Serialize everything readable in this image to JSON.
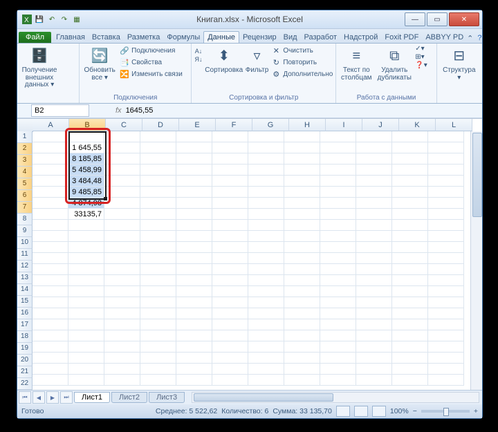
{
  "title": "Книгаn.xlsx - Microsoft Excel",
  "tabs": {
    "file": "Файл",
    "list": [
      "Главная",
      "Вставка",
      "Разметка",
      "Формулы",
      "Данные",
      "Рецензир",
      "Вид",
      "Разработ",
      "Надстрой",
      "Foxit PDF",
      "ABBYY PD"
    ],
    "active": 4
  },
  "ribbon": {
    "g1": {
      "b1": "Получение\nвнешних данных ▾",
      "label": ""
    },
    "g2": {
      "b1": "Обновить\nвсе ▾",
      "s1": "Подключения",
      "s2": "Свойства",
      "s3": "Изменить связи",
      "label": "Подключения"
    },
    "g3": {
      "b1": "Сортировка",
      "b2": "Фильтр",
      "s1": "Очистить",
      "s2": "Повторить",
      "s3": "Дополнительно",
      "label": "Сортировка и фильтр"
    },
    "g4": {
      "b1": "Текст по\nстолбцам",
      "b2": "Удалить\nдубликаты",
      "label": "Работа с данными"
    },
    "g5": {
      "b1": "Структура\n▾",
      "label": ""
    }
  },
  "namebox": "B2",
  "formula": "1645,55",
  "columns": [
    "A",
    "B",
    "C",
    "D",
    "E",
    "F",
    "G",
    "H",
    "I",
    "J",
    "K",
    "L"
  ],
  "rows_count": 23,
  "sel": {
    "col": "B",
    "rows": [
      2,
      3,
      4,
      5,
      6,
      7
    ]
  },
  "data": {
    "B2": "1 645,55",
    "B3": "8 185,85",
    "B4": "5 458,99",
    "B5": "3 484,48",
    "B6": "9 485,85",
    "B7": "4 874,98",
    "B8": "33135,7"
  },
  "sheets": [
    "Лист1",
    "Лист2",
    "Лист3"
  ],
  "status": {
    "ready": "Готово",
    "avg": "Среднее: 5 522,62",
    "count": "Количество: 6",
    "sum": "Сумма: 33 135,70",
    "zoom": "100%"
  }
}
